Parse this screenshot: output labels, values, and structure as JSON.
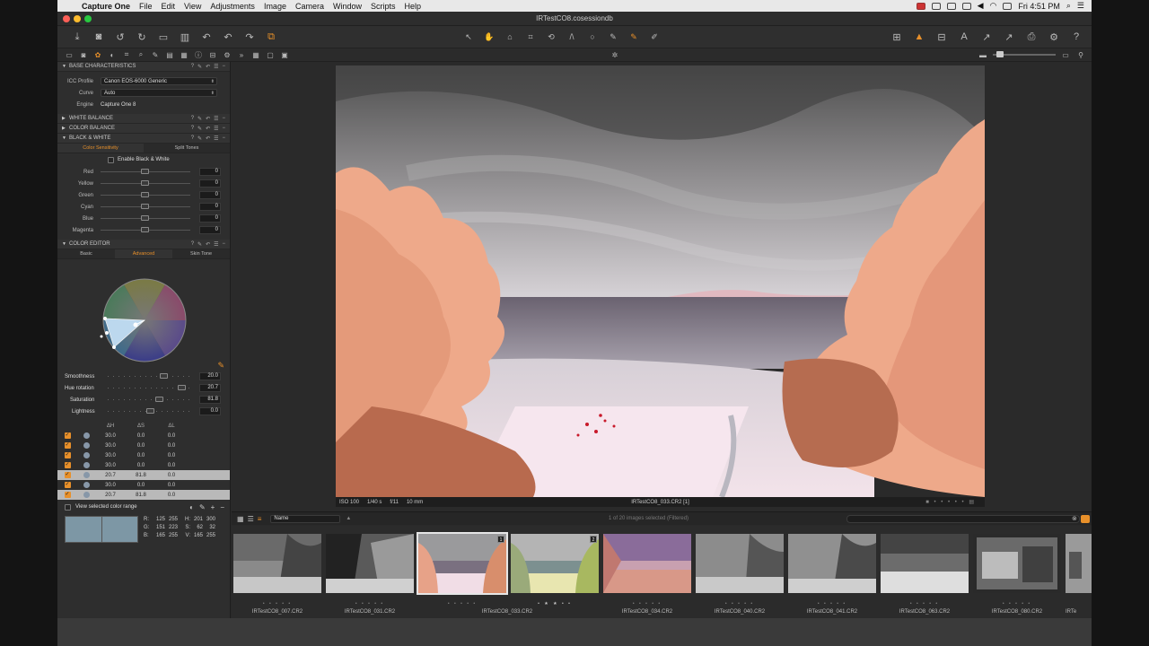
{
  "menubar": {
    "app": "Capture One",
    "items": [
      "File",
      "Edit",
      "View",
      "Adjustments",
      "Image",
      "Camera",
      "Window",
      "Scripts",
      "Help"
    ],
    "clock": "Fri 4:51 PM"
  },
  "window": {
    "title": "IRTestCO8.cosessiondb"
  },
  "left_panel": {
    "base_characteristics": {
      "title": "BASE CHARACTERISTICS",
      "icc_label": "ICC Profile",
      "icc_value": "Canon EOS-6000 Generic",
      "curve_label": "Curve",
      "curve_value": "Auto",
      "engine_label": "Engine",
      "engine_value": "Capture One 8"
    },
    "white_balance": {
      "title": "WHITE BALANCE"
    },
    "color_balance": {
      "title": "COLOR BALANCE"
    },
    "black_white": {
      "title": "BLACK & WHITE",
      "tabs": [
        "Color Sensitivity",
        "Split Tones"
      ],
      "enable_label": "Enable Black & White",
      "sliders": [
        {
          "label": "Red",
          "value": "0"
        },
        {
          "label": "Yellow",
          "value": "0"
        },
        {
          "label": "Green",
          "value": "0"
        },
        {
          "label": "Cyan",
          "value": "0"
        },
        {
          "label": "Blue",
          "value": "0"
        },
        {
          "label": "Magenta",
          "value": "0"
        }
      ]
    },
    "color_editor": {
      "title": "COLOR EDITOR",
      "tabs": [
        "Basic",
        "Advanced",
        "Skin Tone"
      ],
      "sliders": [
        {
          "label": "Smoothness",
          "value": "20.0"
        },
        {
          "label": "Hue rotation",
          "value": "20.7"
        },
        {
          "label": "Saturation",
          "value": "81.8"
        },
        {
          "label": "Lightness",
          "value": "0.0"
        }
      ],
      "columns": [
        "ΔH",
        "ΔS",
        "ΔL"
      ],
      "rows": [
        [
          "30.0",
          "0.0",
          "0.0"
        ],
        [
          "30.0",
          "0.0",
          "0.0"
        ],
        [
          "30.0",
          "0.0",
          "0.0"
        ],
        [
          "30.0",
          "0.0",
          "0.0"
        ],
        [
          "20.7",
          "81.8",
          "0.0"
        ],
        [
          "30.0",
          "0.0",
          "0.0"
        ],
        [
          "20.7",
          "81.8",
          "0.0"
        ]
      ],
      "view_range_label": "View selected color range",
      "readout": {
        "r": "R:",
        "r1": "125",
        "r2": "255",
        "h": "H:",
        "h1": "201",
        "h2": "300",
        "g": "G:",
        "g1": "151",
        "g2": "223",
        "s": "S:",
        "s1": "62",
        "s2": "32",
        "b": "B:",
        "b1": "165",
        "b2": "255",
        "v": "V:",
        "v1": "165",
        "v2": "255"
      }
    }
  },
  "viewer": {
    "iso": "ISO 100",
    "shutter": "1/40 s",
    "aperture": "f/11",
    "focal": "10 mm",
    "filename": "IRTestCO8_033.CR2 [1]"
  },
  "browser": {
    "sort": "Name",
    "count": "1 of 20 images selected (Filtered)"
  },
  "thumbnails": [
    {
      "name": "IRTestCO8_007.CR2",
      "stars": "• • • • •"
    },
    {
      "name": "IRTestCO8_031.CR2",
      "stars": "• • • • •"
    },
    {
      "name": "IRTestCO8_033.CR2",
      "stars": "• • • • •",
      "badge": "1"
    },
    {
      "name": "",
      "stars": "• ★ ★ • •",
      "badge": "2"
    },
    {
      "name": "IRTestCO8_034.CR2",
      "stars": "• • • • •"
    },
    {
      "name": "IRTestCO8_040.CR2",
      "stars": "• • • • •"
    },
    {
      "name": "IRTestCO8_041.CR2",
      "stars": "• • • • •"
    },
    {
      "name": "IRTestCO8_063.CR2",
      "stars": "• • • • •"
    },
    {
      "name": "IRTestCO8_080.CR2",
      "stars": "• • • • •"
    },
    {
      "name": "IRTe",
      "stars": ""
    }
  ],
  "colors": {
    "accent": "#e8902a",
    "panel": "#2e2e2e",
    "selection": "#b9b9b9"
  }
}
